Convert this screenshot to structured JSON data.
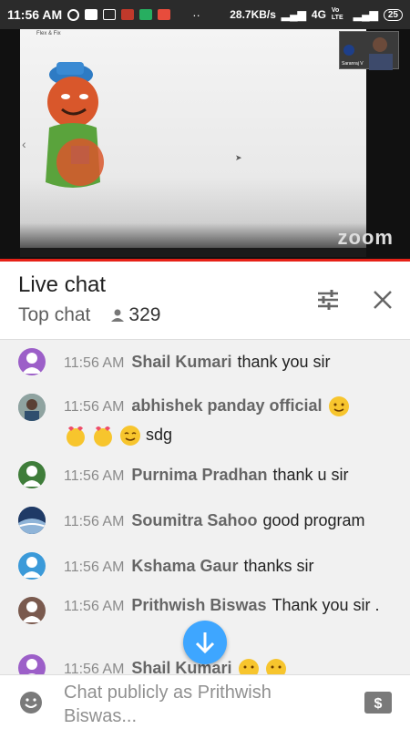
{
  "status_bar": {
    "time": "11:56 AM",
    "speed": "28.7KB/s",
    "network": "4G",
    "carrier": "Vo LTE",
    "battery": "25"
  },
  "video": {
    "tab_title": "Flex & Fix",
    "watermark": "zoom",
    "participant_name": "Saranraj V"
  },
  "header": {
    "title": "Live chat",
    "mode": "Top chat",
    "viewers": "329"
  },
  "messages": [
    {
      "time": "11:56 AM",
      "author": "Shail Kumari",
      "text": "thank you sir",
      "avatar_color": "#9c5fc8"
    },
    {
      "time": "11:56 AM",
      "author": "abhishek panday official",
      "text": "sdg",
      "avatar_color": "#6d8a9e"
    },
    {
      "time": "11:56 AM",
      "author": "Purnima Pradhan",
      "text": "thank u sir",
      "avatar_color": "#3f7d3a"
    },
    {
      "time": "11:56 AM",
      "author": "Soumitra Sahoo",
      "text": "good program",
      "avatar_color": "#4a6a8e"
    },
    {
      "time": "11:56 AM",
      "author": "Kshama Gaur",
      "text": "thanks sir",
      "avatar_color": "#3b9ad9"
    },
    {
      "time": "11:56 AM",
      "author": "Prithwish Biswas",
      "text": "Thank you sir .",
      "avatar_color": "#7a5a4e"
    },
    {
      "time": "11:56 AM",
      "author": "Shail Kumari",
      "text": "",
      "avatar_color": "#9c5fc8"
    }
  ],
  "input": {
    "placeholder": "Chat publicly as Prithwish Biswas..."
  },
  "colors": {
    "accent_red": "#e62117",
    "fab_blue": "#3ea6ff"
  }
}
